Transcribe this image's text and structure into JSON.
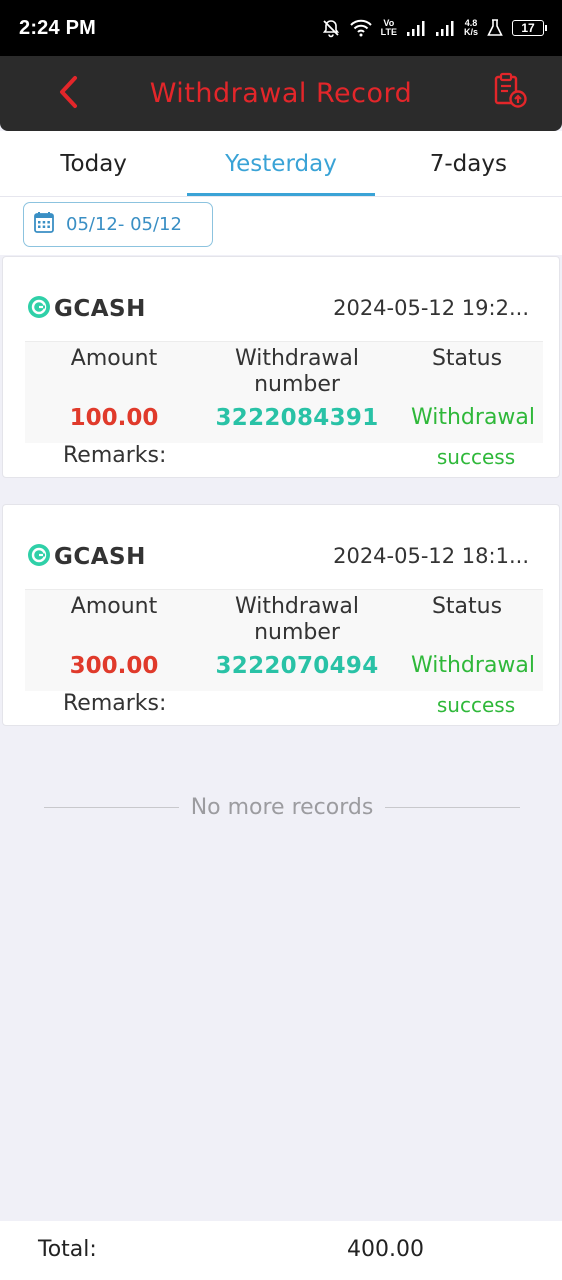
{
  "status_bar": {
    "time": "2:24 PM",
    "net_top": "Vo",
    "net_bottom": "LTE",
    "speed_top": "4.8",
    "speed_bottom": "K/s",
    "battery": "17"
  },
  "header": {
    "title": "Withdrawal Record",
    "back_icon": "chevron-left-icon",
    "upload_icon": "clipboard-upload-icon",
    "accent_color": "#e3262a"
  },
  "tabs": [
    {
      "label": "Today",
      "active": false
    },
    {
      "label": "Yesterday",
      "active": true
    },
    {
      "label": "7-days",
      "active": false
    }
  ],
  "date_filter": {
    "icon": "calendar-icon",
    "value": "05/12- 05/12"
  },
  "columns": {
    "amount": "Amount",
    "number": "Withdrawal number",
    "status": "Status",
    "remarks": "Remarks:"
  },
  "records": [
    {
      "brand": "GCASH",
      "datetime": "2024-05-12 19:2...",
      "amount": "100.00",
      "number": "3222084391",
      "status_line1": "Withdrawal",
      "status_line2": "success"
    },
    {
      "brand": "GCASH",
      "datetime": "2024-05-12 18:1...",
      "amount": "300.00",
      "number": "3222070494",
      "status_line1": "Withdrawal",
      "status_line2": "success"
    }
  ],
  "no_more": "No more records",
  "footer": {
    "total_label": "Total:",
    "total_value": "400.00"
  }
}
